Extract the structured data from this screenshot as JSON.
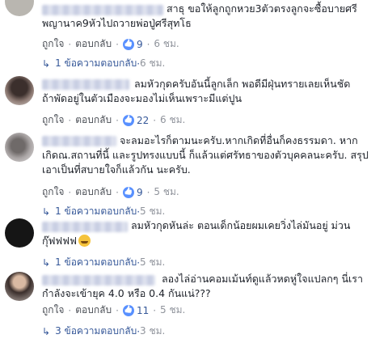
{
  "colors": {
    "link": "#365899",
    "meta": "#90949c",
    "text": "#1d2129",
    "like": "#5890ff"
  },
  "actions": {
    "like": "ถูกใจ",
    "reply": "ตอบกลับ",
    "dot": "·"
  },
  "comments": [
    {
      "name_suffix": "สาธุ",
      "text_lines": [
        "ขอให้ลูกถูกหวย3ตัวตรงลูกจะซื้อบายศรี",
        "พญานาค9หัวไปถวายพ่อปู่ศรีสุทโธ"
      ],
      "likes": "9",
      "time": "6 ชม.",
      "replies": "1 ข้อความตอบกลับ",
      "replies_time": "6 ชม."
    },
    {
      "text_lines": [
        "ลมหัวกุดครับอันนี้ลูกเล็ก พอดีมีฝุ่นทรายเลยเห็นชัด",
        "ถ้าพัดอยู่ในตัวเมืองจะมองไม่เห็นเพราะมีแต่ปูน"
      ],
      "likes": "22",
      "time": "6 ชม."
    },
    {
      "text_lines": [
        "จะลมอะไรก็ตามนะครับ.หากเกิดที่อื่นก็คงธรรมดา. หาก",
        "เกิดณ.สถานที่นี้ และรูปทรงแบบนี้ ก็แล้วแต่ศรัทธาของตัวบุคคลนะครับ. สรุป",
        "เอาเป็นที่สบายใจก็แล้วกัน นะครับ."
      ],
      "likes": "9",
      "time": "5 ชม.",
      "replies": "1 ข้อความตอบกลับ",
      "replies_time": "5 ชม."
    },
    {
      "text_lines": [
        "ลมหัวกุดหันล่ะ ตอนเด็กน้อยผมเคยวิ่งไล่มันอยู่ ม่วน",
        "กุ๊ฟฟฟฟ"
      ],
      "likes": "",
      "time": "5 ชม.",
      "replies": "1 ข้อความตอบกลับ",
      "replies_time": "5 ชม."
    },
    {
      "text_lines": [
        "ลองไล่อ่านคอมเม้นท์ดูแล้วหดหู่ใจแปลกๆ นี่เรา",
        "กำลังจะเข้ายุค 4.0 หรือ 0.4 กันแน่???"
      ],
      "likes": "11",
      "time": "5 ชม.",
      "replies": "3 ข้อความตอบกลับ",
      "replies_time": "3 ชม."
    }
  ]
}
